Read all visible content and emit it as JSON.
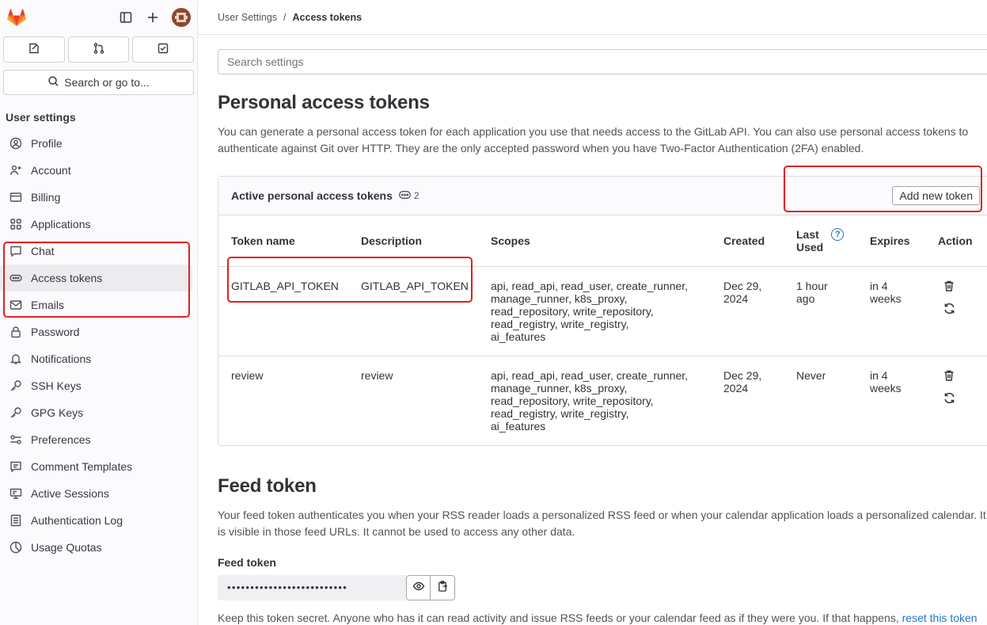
{
  "sidebar": {
    "heading": "User settings",
    "search_label": "Search or go to...",
    "items": [
      {
        "label": "Profile",
        "icon": "profile-icon"
      },
      {
        "label": "Account",
        "icon": "account-icon"
      },
      {
        "label": "Billing",
        "icon": "billing-icon"
      },
      {
        "label": "Applications",
        "icon": "applications-icon"
      },
      {
        "label": "Chat",
        "icon": "chat-icon"
      },
      {
        "label": "Access tokens",
        "icon": "token-icon",
        "active": true
      },
      {
        "label": "Emails",
        "icon": "mail-icon"
      },
      {
        "label": "Password",
        "icon": "lock-icon"
      },
      {
        "label": "Notifications",
        "icon": "bell-icon"
      },
      {
        "label": "SSH Keys",
        "icon": "key-icon"
      },
      {
        "label": "GPG Keys",
        "icon": "key-icon"
      },
      {
        "label": "Preferences",
        "icon": "preferences-icon"
      },
      {
        "label": "Comment Templates",
        "icon": "comment-icon"
      },
      {
        "label": "Active Sessions",
        "icon": "monitor-icon"
      },
      {
        "label": "Authentication Log",
        "icon": "log-icon"
      },
      {
        "label": "Usage Quotas",
        "icon": "quota-icon"
      }
    ]
  },
  "breadcrumb": {
    "parent": "User Settings",
    "separator": "/",
    "current": "Access tokens"
  },
  "search_settings": {
    "placeholder": "Search settings"
  },
  "pat": {
    "title": "Personal access tokens",
    "description": "You can generate a personal access token for each application you use that needs access to the GitLab API. You can also use personal access tokens to authenticate against Git over HTTP. They are the only accepted password when you have Two-Factor Authentication (2FA) enabled.",
    "card_title": "Active personal access tokens",
    "count": "2",
    "add_button": "Add new token",
    "columns": {
      "name": "Token name",
      "description": "Description",
      "scopes": "Scopes",
      "created": "Created",
      "last_used_1": "Last",
      "last_used_2": "Used",
      "expires": "Expires",
      "action": "Action"
    },
    "rows": [
      {
        "name": "GITLAB_API_TOKEN",
        "description": "GITLAB_API_TOKEN",
        "scopes": [
          "api, read_api, read_user, create_runner,",
          "manage_runner, k8s_proxy,",
          "read_repository, write_repository,",
          "read_registry, write_registry,",
          "ai_features"
        ],
        "created": [
          "Dec 29,",
          "2024"
        ],
        "last_used": [
          "1 hour",
          "ago"
        ],
        "expires": [
          "in 4",
          "weeks"
        ]
      },
      {
        "name": "review",
        "description": "review",
        "scopes": [
          "api, read_api, read_user, create_runner,",
          "manage_runner, k8s_proxy,",
          "read_repository, write_repository,",
          "read_registry, write_registry,",
          "ai_features"
        ],
        "created": [
          "Dec 29,",
          "2024"
        ],
        "last_used": [
          "Never",
          ""
        ],
        "expires": [
          "in 4",
          "weeks"
        ]
      }
    ]
  },
  "feed": {
    "title": "Feed token",
    "description": "Your feed token authenticates you when your RSS reader loads a personalized RSS feed or when your calendar application loads a personalized calendar. It is visible in those feed URLs. It cannot be used to access any other data.",
    "label": "Feed token",
    "masked_value": "••••••••••••••••••••••••••",
    "note": "Keep this token secret. Anyone who has it can read activity and issue RSS feeds or your calendar feed as if they were you. If that happens,",
    "reset_link": "reset this token"
  },
  "colors": {
    "accent_link": "#1f75cb",
    "highlight_box": "#e02020",
    "gitlab_orange": "#fc6d26"
  }
}
